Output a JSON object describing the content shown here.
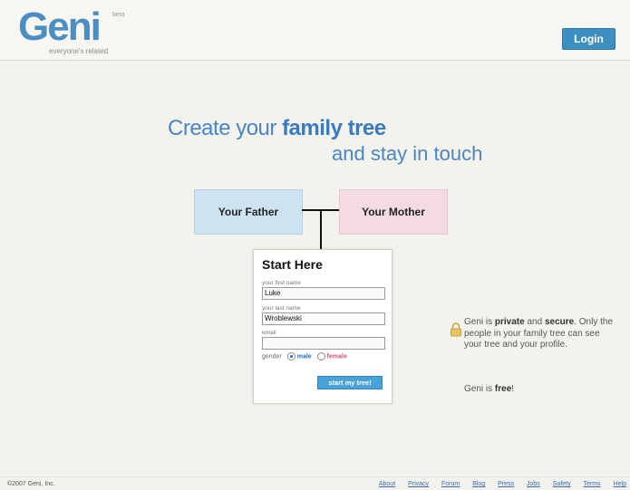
{
  "header": {
    "logo_text": "Geni",
    "logo_beta": "beta",
    "tagline": "everyone's related",
    "login_label": "Login"
  },
  "hero": {
    "headline_plain": "Create your ",
    "headline_bold": "family tree",
    "subheadline": "and stay in touch"
  },
  "tree": {
    "father_label": "Your Father",
    "mother_label": "Your Mother"
  },
  "form": {
    "title": "Start Here",
    "first_name_label": "your first name",
    "first_name_value": "Luke",
    "last_name_label": "your last name",
    "last_name_value": "Wroblewski",
    "email_label": "email",
    "email_value": "",
    "gender_label": "gender",
    "male_label": "male",
    "female_label": "female",
    "selected_gender": "male",
    "submit_label": "start my tree!"
  },
  "info": {
    "line_prefix": "Geni is ",
    "private": "private",
    "and": " and ",
    "secure": "secure",
    "line_rest": ". Only the people in your family tree can see your tree and your profile.",
    "free_prefix": "Geni is ",
    "free": "free",
    "free_suffix": "!"
  },
  "footer": {
    "copyright": "©2007 Geni, Inc.",
    "links": [
      "About",
      "Privacy",
      "Forum",
      "Blog",
      "Press",
      "Jobs",
      "Safety",
      "Terms",
      "Help"
    ]
  },
  "colors": {
    "accent": "#4a86c6",
    "login_button": "#3d8fc2",
    "father_box": "#cde3f1",
    "mother_box": "#f4dbe3",
    "background": "#f3f2ec"
  },
  "icons": [
    "lock-icon"
  ]
}
